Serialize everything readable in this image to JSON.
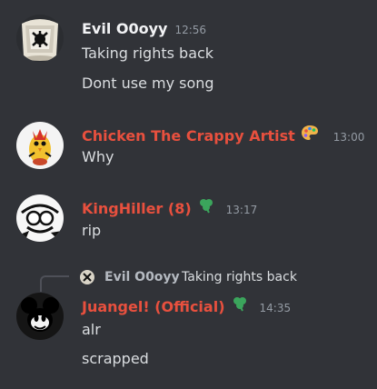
{
  "colors": {
    "background": "#313338",
    "text": "#dbdee1",
    "muted": "#949ba4",
    "red_role": "#e8503e",
    "white_name": "#f2f3f5"
  },
  "messages": [
    {
      "username": "Evil O0oyy",
      "timestamp": "12:56",
      "avatar": "toilet-avatar",
      "lines": [
        "Taking rights back",
        "Dont use my song"
      ]
    },
    {
      "username": "Chicken The Crappy Artist",
      "timestamp": "13:00",
      "avatar": "chicken-avatar",
      "badge": "palette-icon",
      "lines": [
        "Why"
      ]
    },
    {
      "username": "KingHiller (8)",
      "timestamp": "13:17",
      "avatar": "sketch-avatar",
      "badge": "clover-icon",
      "lines": [
        "rip"
      ]
    },
    {
      "reply_to": {
        "username": "Evil O0oyy",
        "text": "Taking rights back"
      },
      "username": "Juangel! (Official)",
      "timestamp": "14:35",
      "avatar": "mickey-avatar",
      "badge": "clover-icon",
      "lines": [
        "alr",
        "scrapped"
      ]
    }
  ]
}
